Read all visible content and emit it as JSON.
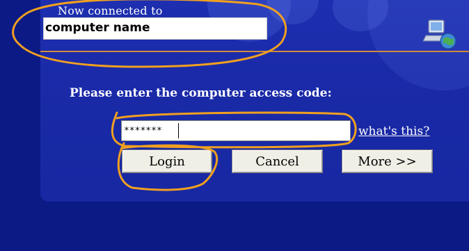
{
  "dialog": {
    "connected_label": "Now connected to",
    "computer_name": "computer name",
    "prompt": "Please enter the computer access code:",
    "access_code_value": "*******",
    "help_link": "what's this?",
    "buttons": {
      "login": "Login",
      "cancel": "Cancel",
      "more": "More >>"
    }
  },
  "icons": {
    "logo": "network-computer-icon"
  },
  "colors": {
    "background": "#0b1a85",
    "panel": "#1a2aa8",
    "divider": "#d08a3a",
    "annotation": "#f0a020"
  }
}
